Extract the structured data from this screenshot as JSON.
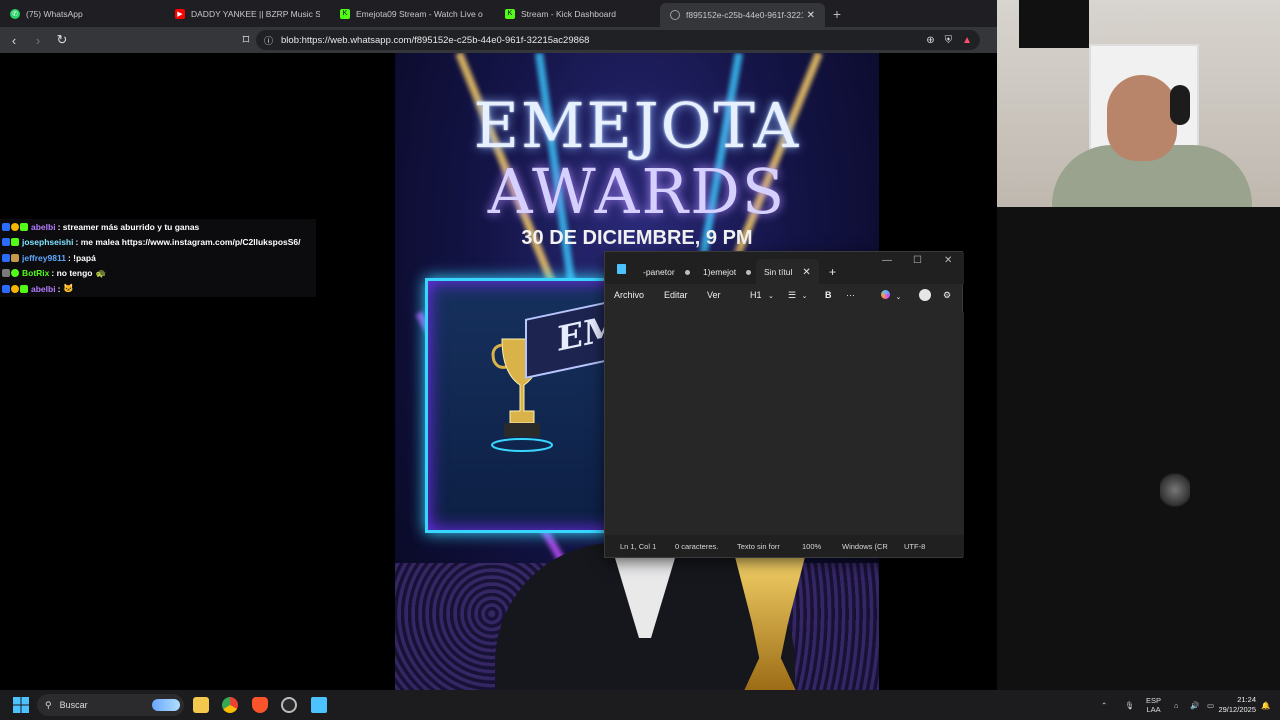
{
  "browser": {
    "tabs": [
      {
        "label": "(75) WhatsApp",
        "icon": "whatsapp-icon",
        "color": "#25d366"
      },
      {
        "label": "DADDY YANKEE || BZRP Music Se",
        "icon": "youtube-icon",
        "color": "#ff0000"
      },
      {
        "label": "Emejota09 Stream - Watch Live o",
        "icon": "kick-icon",
        "color": "#53fc18"
      },
      {
        "label": "Stream - Kick Dashboard",
        "icon": "kick-icon",
        "color": "#53fc18"
      },
      {
        "label": "f895152e-c25b-44e0-961f-3221",
        "icon": "globe-icon",
        "color": "#9aa0a6"
      }
    ],
    "new_tab": "+",
    "address": "blob:https://web.whatsapp.com/f895152e-c25b-44e0-961f-32215ac29868"
  },
  "poster": {
    "title_line1": "EMEJOTA",
    "title_line2": "AWARDS",
    "date": "30 DE DICIEMBRE, 9 PM",
    "banner_text": "EM"
  },
  "chat": {
    "messages": [
      {
        "user": "abelbi",
        "user_color": "#b57cff",
        "text": ": streamer más aburrido y tu ganas"
      },
      {
        "user": "josephseishi",
        "user_color": "#7fe3ff",
        "text": ": me malea https://www.instagram.com/p/C2lluksposS6/"
      },
      {
        "user": "jeffrey9811",
        "user_color": "#5fa8ff",
        "text": ": !papá"
      },
      {
        "user": "BotRix",
        "user_color": "#53fc18",
        "text": ": no tengo"
      },
      {
        "user": "abelbi",
        "user_color": "#b57cff",
        "text": ":"
      }
    ]
  },
  "notepad": {
    "tabs": [
      "-panetor",
      "1)emejot",
      "Sin títul"
    ],
    "menu": [
      "Archivo",
      "Editar",
      "Ver"
    ],
    "heading": "H1",
    "bold": "B",
    "more": "···",
    "status": {
      "position": "Ln 1, Col 1",
      "chars": "0 caracteres.",
      "format": "Texto sin forr",
      "zoom": "100%",
      "eol": "Windows (CR",
      "encoding": "UTF-8"
    }
  },
  "taskbar": {
    "search_label": "Buscar",
    "lang_line1": "ESP",
    "lang_line2": "LAA",
    "time": "21:24",
    "date": "29/12/2025"
  }
}
